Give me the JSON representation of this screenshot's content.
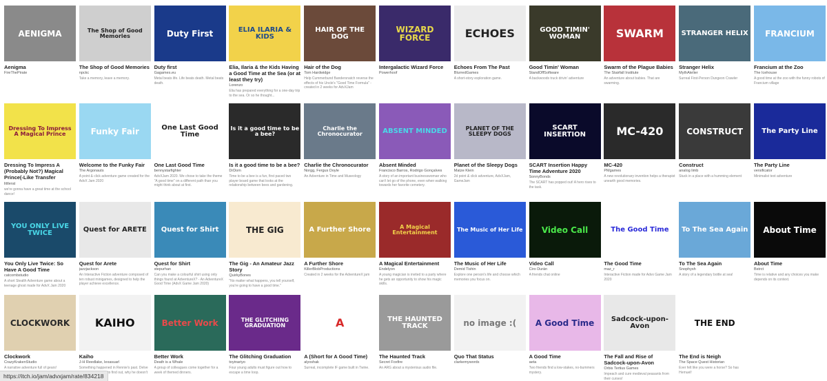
{
  "status_url": "https://itch.io/jam/advxjam/rate/834218",
  "rows": [
    [
      {
        "title": "Aenigma",
        "author": "FireThePirate",
        "desc": "",
        "thumb_text": "AENIGMA",
        "bg": "#8a8a8a",
        "fg": "#ffffff"
      },
      {
        "title": "The Shop of Good Memories",
        "author": "npckc",
        "desc": "Take a memory, leave a memory.",
        "thumb_text": "The Shop of Good Memories",
        "bg": "#cfcfcf",
        "fg": "#222222"
      },
      {
        "title": "Duty first",
        "author": "Gagames.eu",
        "desc": "Metal beats life. Life beats death. Metal beats death.",
        "thumb_text": "Duty First",
        "bg": "#1a3a8a",
        "fg": "#ffffff"
      },
      {
        "title": "Elia, Ilaria & the Kids Having a Good Time at the Sea (or at least they try)",
        "author": "Lorenzo",
        "desc": "Elia has prepared everything for a one-day trip to the sea. Or so he thought...",
        "thumb_text": "ELIA ILARIA & KIDS",
        "bg": "#f2d24a",
        "fg": "#1d4a8a"
      },
      {
        "title": "Hair of the Dog",
        "author": "Tom Hardwidge",
        "desc": "Help Cummerbund Bandersnatch reverse the effects of his Uncle's \"Good Time Formula\" - created in 2 weeks for AdvXJam",
        "thumb_text": "HAIR OF THE DOG",
        "bg": "#6b4a3a",
        "fg": "#ffffff"
      },
      {
        "title": "Intergalactic Wizard Force",
        "author": "Powerhoof",
        "desc": "",
        "thumb_text": "WIZARD FORCE",
        "bg": "#3a2a6a",
        "fg": "#e8d84a"
      },
      {
        "title": "Echoes From The Past",
        "author": "BlurredGames",
        "desc": "A short-story exploration game.",
        "thumb_text": "ECHOES",
        "bg": "#ececec",
        "fg": "#222222"
      },
      {
        "title": "Good Timin' Woman",
        "author": "StandOffSoftware",
        "desc": "A backwoods truck drivin' adventure",
        "thumb_text": "GOOD TIMIN' WOMAN",
        "bg": "#3a3a2a",
        "fg": "#ffffff"
      },
      {
        "title": "Swarm of the Plague Babies",
        "author": "The Stairfall Institute",
        "desc": "An adventure about babies. That are swarming.",
        "thumb_text": "SWARM",
        "bg": "#b8323a",
        "fg": "#ffffff"
      },
      {
        "title": "Stranger Helix",
        "author": "MythAtelier",
        "desc": "Surreal First-Person Dungeon Crawler",
        "thumb_text": "STRANGER HELIX",
        "bg": "#4a6a7a",
        "fg": "#ffffff"
      },
      {
        "title": "Francium at the Zoo",
        "author": "The Icehouse",
        "desc": "A good time at the zoo with the funny robots of Francium village",
        "thumb_text": "FRANCIUM",
        "bg": "#7ab8e8",
        "fg": "#ffffff"
      }
    ],
    [
      {
        "title": "Dressing To Impress A (Probably Not?) Magical Prince(-Like Transfer Student)!",
        "author": "littlerat",
        "desc": "we're gonna have a great time at the school dance!",
        "thumb_text": "Dressing To Impress A Magical Prince",
        "bg": "#f2e24a",
        "fg": "#8a1a3a"
      },
      {
        "title": "Welcome to the Funky Fair",
        "author": "The Argonauts",
        "desc": "A point & click adventure game created for the AdvX Jam 2020",
        "thumb_text": "Funky Fair",
        "bg": "#9ad8f2",
        "fg": "#ffffff"
      },
      {
        "title": "One Last Good Time",
        "author": "bennystarfighter",
        "desc": "AdvXJam 2020. We chose to take the theme \"A good time\" on a different path than you might think about at first.",
        "thumb_text": "One Last Good Time",
        "bg": "#ffffff",
        "fg": "#222222"
      },
      {
        "title": "Is it a good time to be a bee?",
        "author": "DrDom",
        "desc": "Time to be a bee is a fun, first paced two player board game that looks at the relationship between bees and gardening.",
        "thumb_text": "Is it a good time to be a bee?",
        "bg": "#2a2a2a",
        "fg": "#ffffff"
      },
      {
        "title": "Charlie the Chronocurator",
        "author": "Norgg, Fergus Doyle",
        "desc": "An Adventure in Time and Museology",
        "thumb_text": "Charlie the Chronocurator",
        "bg": "#6a7a8a",
        "fg": "#ffffff"
      },
      {
        "title": "Absent Minded",
        "author": "Francisco Barros, Rodrigo Gonçalves",
        "desc": "A story of an important businesswoman who can't let go of the phone, even when walking towards her favorite cemetery.",
        "thumb_text": "ABSENT MINDED",
        "bg": "#8a5ab8",
        "fg": "#4ad8e8"
      },
      {
        "title": "Planet of the Sleepy Dogs",
        "author": "Matze Klein",
        "desc": "2d point & click adventure, AdvXJam, GameJam",
        "thumb_text": "PLANET OF THE SLEEPY DOGS",
        "bg": "#b8b8c8",
        "fg": "#222222"
      },
      {
        "title": "SCART Insertion Happy Time Adventure 2020",
        "author": "SonnyBonds",
        "desc": "The SCART has popped out! A hero rises to the task.",
        "thumb_text": "SCART INSERTION",
        "bg": "#0a0a2a",
        "fg": "#ffffff"
      },
      {
        "title": "MC-420",
        "author": "PMgames",
        "desc": "A new revolutionary invention helps a therapist unearth good memories.",
        "thumb_text": "MC-420",
        "bg": "#2a2a2a",
        "fg": "#ffffff"
      },
      {
        "title": "Construct",
        "author": "analog limb",
        "desc": "Stuck in a place with a humming element",
        "thumb_text": "CONSTRUCT",
        "bg": "#3a3a3a",
        "fg": "#ffffff"
      },
      {
        "title": "The Party Line",
        "author": "versificator",
        "desc": "Minimalist text adventure",
        "thumb_text": "The Party Line",
        "bg": "#1a2a9a",
        "fg": "#ffffff"
      }
    ],
    [
      {
        "title": "You Only Live Twice: So Have A Good Time",
        "author": "catcombstudio",
        "desc": "A short Stealth Adventure game about a teenage ghost made for AdvX Jam 2020",
        "thumb_text": "YOU ONLY LIVE TWICE",
        "bg": "#1a4a6a",
        "fg": "#4ad8e8"
      },
      {
        "title": "Quest for Arete",
        "author": "jazzjackson",
        "desc": "An Interactive Fiction adventure composed of ten robust minigames, designed to help the player achieve excellence.",
        "thumb_text": "Quest for ARETE",
        "bg": "#e8e8e8",
        "fg": "#222222"
      },
      {
        "title": "Quest for Shirt",
        "author": "stepurhan",
        "desc": "Can you make a colourful shirt using only things found at AdventureX? - An AdventureX Good Time (AdvX Game Jam 2020)",
        "thumb_text": "Quest for Shirt",
        "bg": "#3a8ab8",
        "fg": "#ffffff"
      },
      {
        "title": "The Gig - An Amateur Jazz Story",
        "author": "QuirkyBones",
        "desc": "\"No matter what happens, you tell yourself, you're going to have a good time.\"",
        "thumb_text": "THE GIG",
        "bg": "#f8ead0",
        "fg": "#222222"
      },
      {
        "title": "A Further Shore",
        "author": "KillerBlobProductions",
        "desc": "Created in 2 weeks for the AdventureX jam",
        "thumb_text": "A Further Shore",
        "bg": "#c8a84a",
        "fg": "#ffffff"
      },
      {
        "title": "A Magical Entertainment",
        "author": "Endelyon",
        "desc": "A young magician is invited to a party where he gets an opportunity to show his magic skills.",
        "thumb_text": "A Magical Entertainment",
        "bg": "#9a2a2a",
        "fg": "#f2d24a"
      },
      {
        "title": "The Music of Her Life",
        "author": "Demid Tishin",
        "desc": "Explore one person's life and choose which memories you focus on.",
        "thumb_text": "The Music of Her Life",
        "bg": "#2a5ad8",
        "fg": "#ffffff"
      },
      {
        "title": "Video Call",
        "author": "Ciro Durán",
        "desc": "A friends chat online",
        "thumb_text": "Video Call",
        "bg": "#0a1a0a",
        "fg": "#4ae84a"
      },
      {
        "title": "The Good Time",
        "author": "maz_r",
        "desc": "Interactive Fiction made for Advx Game Jam 2020",
        "thumb_text": "The Good Time",
        "bg": "#ffffff",
        "fg": "#2a2ad8"
      },
      {
        "title": "To The Sea Again",
        "author": "Snophysh",
        "desc": "A story of a legendary bottle at sea!",
        "thumb_text": "To The Sea Again",
        "bg": "#6aa8d8",
        "fg": "#ffffff"
      },
      {
        "title": "About Time",
        "author": "Bstrct",
        "desc": "Time is relative and any choices you make depends on its context.",
        "thumb_text": "About Time",
        "bg": "#0a0a0a",
        "fg": "#ffffff"
      }
    ],
    [
      {
        "title": "Clockwork",
        "author": "CrazyKrakenStudio",
        "desc": "A narrative adventure full of gears!",
        "thumb_text": "CLOCKWORK",
        "bg": "#e0d0b0",
        "fg": "#2a2a2a"
      },
      {
        "title": "Kaiho",
        "author": "J-H Reedlake, lexasuarl",
        "desc": "Something happened in Rennie's past. Delve into her memories to find out, why he doesn't dare to fall in love.",
        "thumb_text": "KAIHO",
        "bg": "#f2f2f2",
        "fg": "#111111"
      },
      {
        "title": "Better Work",
        "author": "Death is a Whale",
        "desc": "A group of colleagues come together for a week of themed dinners.",
        "thumb_text": "Better Work",
        "bg": "#2a6a5a",
        "fg": "#e84a4a"
      },
      {
        "title": "The Glitching Graduation",
        "author": "toyinariyo",
        "desc": "Four young adults must figure out how to escape a time loop.",
        "thumb_text": "THE GLITCHING GRADUATION",
        "bg": "#6a2a8a",
        "fg": "#ffffff"
      },
      {
        "title": "A (Short for A Good Time)",
        "author": "alyoshak",
        "desc": "Surreal, incomplete IF game built in Twine.",
        "thumb_text": "A",
        "bg": "#ffffff",
        "fg": "#d82a2a"
      },
      {
        "title": "The Haunted Track",
        "author": "Secret Foxfire",
        "desc": "An ARG about a mysterious audio file.",
        "thumb_text": "THE HAUNTED TRACK",
        "bg": "#9a9a9a",
        "fg": "#ffffff"
      },
      {
        "title": "Quo That Status",
        "author": "clarkemywords",
        "desc": "",
        "thumb_text": "no image :(",
        "bg": "#f2f2f2",
        "fg": "#777777"
      },
      {
        "title": "A Good Time",
        "author": "aeta",
        "desc": "Two friends find a low-stakes, no-bummers mystery.",
        "thumb_text": "A Good Time",
        "bg": "#e8b8e8",
        "fg": "#2a2a8a"
      },
      {
        "title": "The Fall and Rise of Sadcock-upon-Avon",
        "author": "Orbis Tertius Games",
        "desc": "Impeach and cure medieval peasants from their curses!",
        "thumb_text": "Sadcock-upon-Avon",
        "bg": "#e8e8e8",
        "fg": "#222222"
      },
      {
        "title": "The End is Neigh",
        "author": "The Space Quest Historian",
        "desc": "Ever felt like you were a horse? So has Hemuel!",
        "thumb_text": "THE END",
        "bg": "#ffffff",
        "fg": "#111111"
      }
    ]
  ]
}
